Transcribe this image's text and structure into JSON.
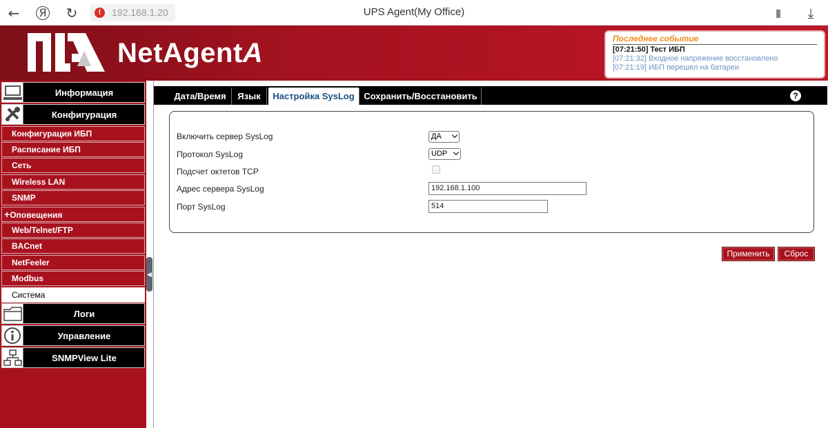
{
  "browser": {
    "back_icon": "←",
    "yandex_icon": "Я",
    "reload_icon": "↻",
    "address": "192.168.1.20",
    "title": "UPS Agent(My Office)",
    "bookmark_icon": "▮",
    "download_icon": "⤓"
  },
  "header": {
    "brand": "NetAgent",
    "brand_suffix": "A",
    "events": {
      "title": "Последнее событие",
      "lines": [
        "[07:21:50] Тест ИБП",
        "[07:21:32] Входное напряжение восстановлено",
        "[07:21:19] ИБП перешел на батареи"
      ]
    }
  },
  "sidebar": {
    "main": [
      {
        "label": "Информация",
        "icon": "monitor-icon"
      },
      {
        "label": "Конфигурация",
        "icon": "tools-icon"
      },
      {
        "label": "Логи",
        "icon": "folder-icon"
      },
      {
        "label": "Управление",
        "icon": "info-icon"
      },
      {
        "label": "SNMPView Lite",
        "icon": "network-icon"
      }
    ],
    "sub": [
      "Конфигурация ИБП",
      "Расписание ИБП",
      "Сеть",
      "Wireless LAN",
      "SNMP",
      "Оповещения",
      "Web/Telnet/FTP",
      "BACnet",
      "NetFeeler",
      "Modbus",
      "Система"
    ],
    "plus_sign": "+"
  },
  "tabs": [
    "Дата/Время",
    "Язык",
    "Настройка SysLog",
    "Сохранить/Восстановить"
  ],
  "help": "?",
  "form": {
    "enable_label": "Включить сервер SysLog",
    "enable_value": "ДА",
    "protocol_label": "Протокол SysLog",
    "protocol_value": "UDP",
    "octet_label": "Подсчет октетов TCP",
    "server_label": "Адрес сервера SysLog",
    "server_value": "192.168.1.100",
    "port_label": "Порт SysLog",
    "port_value": "514"
  },
  "buttons": {
    "apply": "Применить",
    "reset": "Сброс"
  },
  "colors": {
    "brand_red": "#a8121f",
    "event_title": "#f28c1d",
    "active_tab_text": "#1a4f80"
  }
}
